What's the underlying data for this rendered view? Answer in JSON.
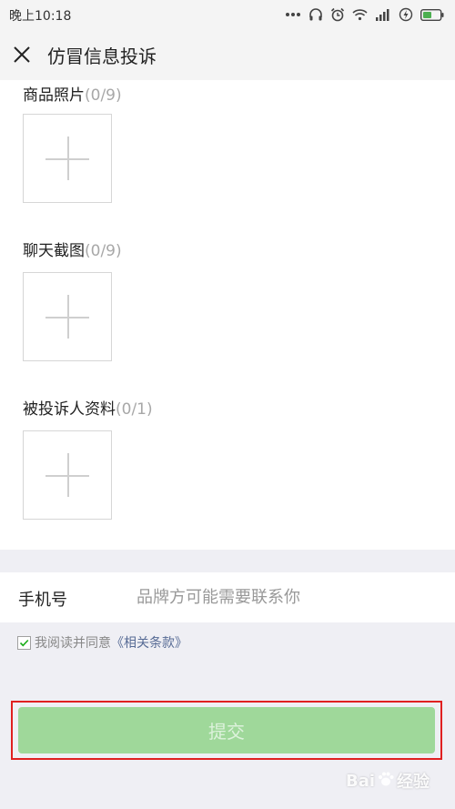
{
  "status_bar": {
    "time": "晚上10:18",
    "icons": [
      "more-dots-icon",
      "headphones-icon",
      "alarm-icon",
      "wifi-icon",
      "signal-icon",
      "charging-icon",
      "battery-icon"
    ]
  },
  "nav": {
    "title": "仿冒信息投诉",
    "close_icon": "close-icon"
  },
  "uploads": [
    {
      "label": "商品照片",
      "count": "(0/9)"
    },
    {
      "label": "聊天截图",
      "count": "(0/9)"
    },
    {
      "label": "被投诉人资料",
      "count": "(0/1)"
    }
  ],
  "phone": {
    "label": "手机号",
    "placeholder": "品牌方可能需要联系你",
    "value": ""
  },
  "agreement": {
    "checked": true,
    "text": "我阅读并同意",
    "link": "《相关条款》"
  },
  "submit": {
    "label": "提交",
    "color": "#9fd89a",
    "highlight_color": "#e02020"
  },
  "watermark": {
    "text_a": "Bai",
    "text_b": "经验"
  }
}
